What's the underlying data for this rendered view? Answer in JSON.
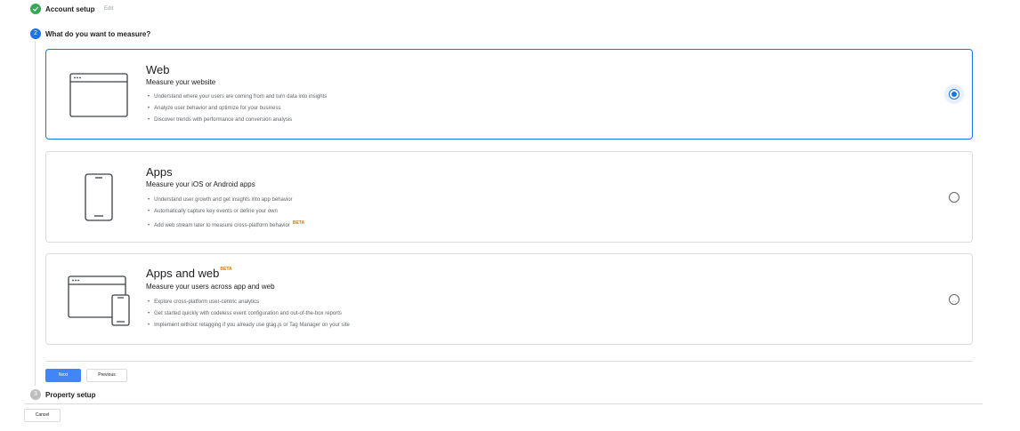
{
  "steps": {
    "account": {
      "title": "Account setup",
      "edit_label": "Edit"
    },
    "measure": {
      "number": "2",
      "title": "What do you want to measure?"
    },
    "property": {
      "number": "3",
      "title": "Property setup"
    }
  },
  "options": [
    {
      "title": "Web",
      "subtitle": "Measure your website",
      "bullets": [
        "Understand where your users are coming from and turn data into insights",
        "Analyze user behavior and optimize for your business",
        "Discover trends with performance and conversion analysis"
      ],
      "selected": true
    },
    {
      "title": "Apps",
      "subtitle": "Measure your iOS or Android apps",
      "bullets": [
        "Understand user growth and get insights into app behavior",
        "Automatically capture key events or define your own",
        "Add web stream later to measure cross-platform behavior"
      ],
      "bullet_badge": "BETA",
      "selected": false
    },
    {
      "title": "Apps and web",
      "title_badge": "BETA",
      "subtitle": "Measure your users across app and web",
      "bullets": [
        "Explore cross-platform user-centric analytics",
        "Get started quickly with codeless event configuration and out-of-the-box reports",
        "Implement without retagging if you already use gtag.js or Tag Manager on your site"
      ],
      "selected": false
    }
  ],
  "buttons": {
    "next": "Next",
    "previous": "Previous",
    "cancel": "Cancel"
  },
  "colors": {
    "accent": "#1a73e8",
    "success": "#34a853",
    "beta": "#e37400",
    "next_button": "#4285f4"
  }
}
